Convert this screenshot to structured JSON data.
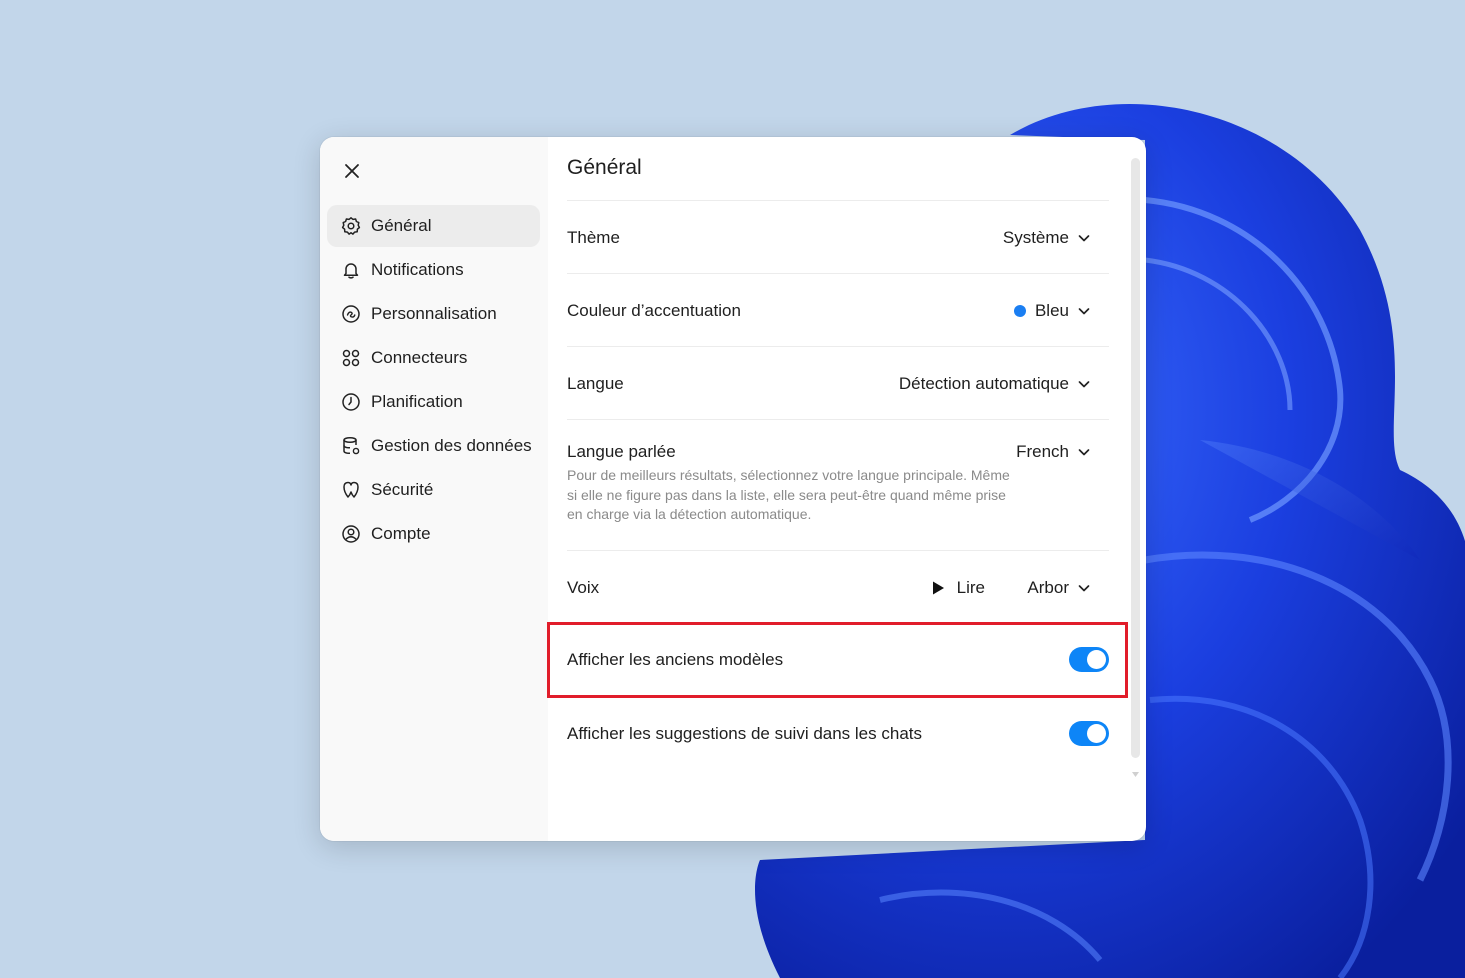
{
  "sidebar": {
    "items": [
      {
        "label": "Général",
        "icon": "gear-icon",
        "active": true
      },
      {
        "label": "Notifications",
        "icon": "bell-icon"
      },
      {
        "label": "Personnalisation",
        "icon": "personalization-icon"
      },
      {
        "label": "Connecteurs",
        "icon": "connectors-icon"
      },
      {
        "label": "Planification",
        "icon": "clock-icon"
      },
      {
        "label": "Gestion des données",
        "icon": "database-icon"
      },
      {
        "label": "Sécurité",
        "icon": "shield-icon"
      },
      {
        "label": "Compte",
        "icon": "account-icon"
      }
    ]
  },
  "content": {
    "title": "Général",
    "theme": {
      "label": "Thème",
      "value": "Système"
    },
    "accent": {
      "label": "Couleur d’accentuation",
      "value": "Bleu",
      "color": "#1a7ef2"
    },
    "language": {
      "label": "Langue",
      "value": "Détection automatique"
    },
    "spoken_language": {
      "label": "Langue parlée",
      "value": "French",
      "help_line1": "Pour de meilleurs résultats, sélectionnez votre langue principale. Même",
      "help_line2": "si elle ne figure pas dans la liste, elle sera peut-être quand même prise",
      "help_line3": "en charge via la détection automatique."
    },
    "voice": {
      "label": "Voix",
      "play_label": "Lire",
      "value": "Arbor"
    },
    "legacy_models": {
      "label": "Afficher les anciens modèles",
      "enabled": true
    },
    "follow_up": {
      "label": "Afficher les suggestions de suivi dans les chats",
      "enabled": true
    }
  },
  "colors": {
    "toggle_on": "#0d85f7",
    "highlight": "#e11d2a",
    "accent_blue": "#1a7ef2"
  }
}
